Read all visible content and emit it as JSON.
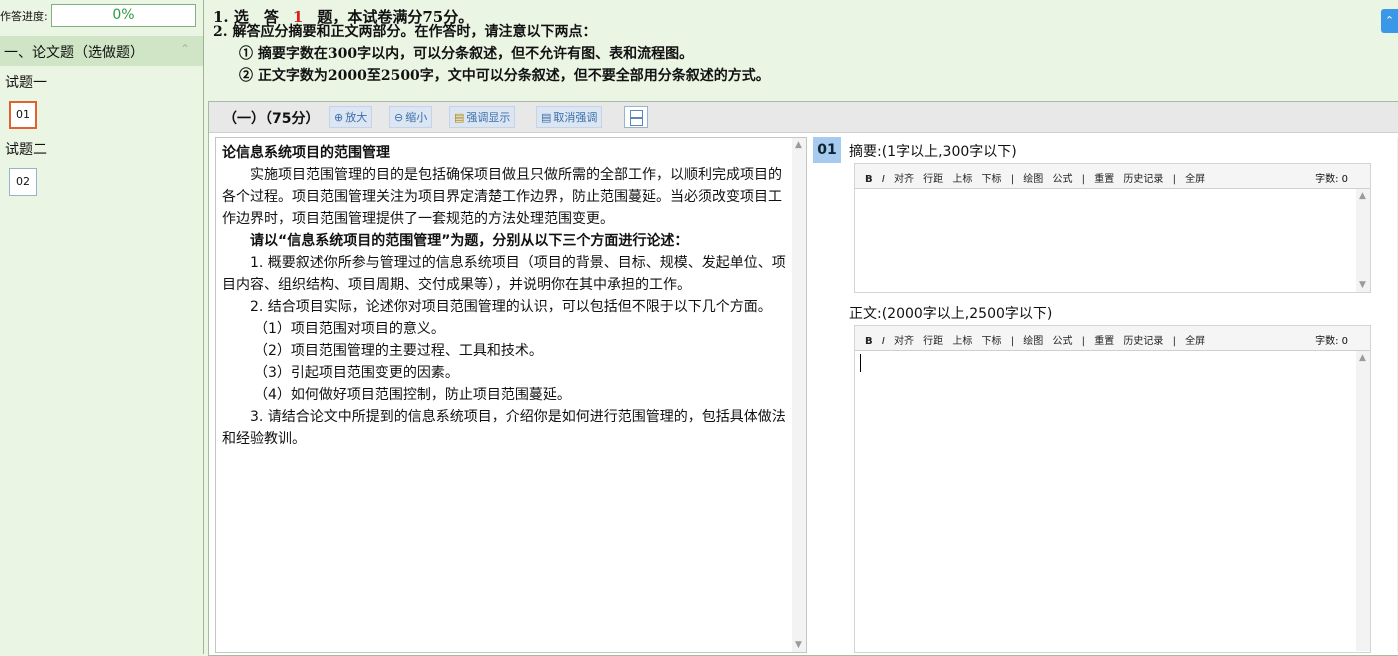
{
  "sidebar": {
    "progress_label": "作答进度:",
    "progress_value": "0%",
    "section_title": "一、论文题（选做题）",
    "groups": [
      {
        "label": "试题一",
        "question": "01"
      },
      {
        "label": "试题二",
        "question": "02"
      }
    ]
  },
  "instructions": {
    "line1_prefix": "1. 选　答",
    "line1_count": "1",
    "line1_suffix": "题，本试卷满分75分。",
    "line2": "2. 解答应分摘要和正文两部分。在作答时，请注意以下两点：",
    "line3": "① 摘要字数在300字以内，可以分条叙述，但不允许有图、表和流程图。",
    "line4": "② 正文字数为2000至2500字，文中可以分条叙述，但不要全部用分条叙述的方式。",
    "toggle_icon": "double-chevron-up-icon"
  },
  "toolbar": {
    "question_label": "（一）（75分）",
    "zoom_in": "放大",
    "zoom_out": "缩小",
    "highlight": "强调显示",
    "cancel_highlight": "取消强调"
  },
  "question": {
    "title": "论信息系统项目的范围管理",
    "p1": "实施项目范围管理的目的是包括确保项目做且只做所需的全部工作，以顺利完成项目的各个过程。项目范围管理关注为项目界定清楚工作边界，防止范围蔓延。当必须改变项目工作边界时，项目范围管理提供了一套规范的方法处理范围变更。",
    "p2": "请以“信息系统项目的范围管理”为题，分别从以下三个方面进行论述：",
    "p3": "1. 概要叙述你所参与管理过的信息系统项目（项目的背景、目标、规模、发起单位、项目内容、组织结构、项目周期、交付成果等），并说明你在其中承担的工作。",
    "p4": "2. 结合项目实际，论述你对项目范围管理的认识，可以包括但不限于以下几个方面。",
    "sub1": "（1）项目范围对项目的意义。",
    "sub2": "（2）项目范围管理的主要过程、工具和技术。",
    "sub3": "（3）引起项目范围变更的因素。",
    "sub4": "（4）如何做好项目范围控制，防止项目范围蔓延。",
    "p5": "3. 请结合论文中所提到的信息系统项目，介绍你是如何进行范围管理的，包括具体做法和经验教训。"
  },
  "answer": {
    "number": "01",
    "abstract_label": "摘要:(1字以上,300字以下)",
    "body_label": "正文:(2000字以上,2500字以下)",
    "editor_tools": [
      "B",
      "I",
      "对齐",
      "行距",
      "上标",
      "下标",
      "|",
      "绘图",
      "公式",
      "|",
      "重置",
      "历史记录",
      "|",
      "全屏"
    ],
    "count_label": "字数: 0"
  }
}
